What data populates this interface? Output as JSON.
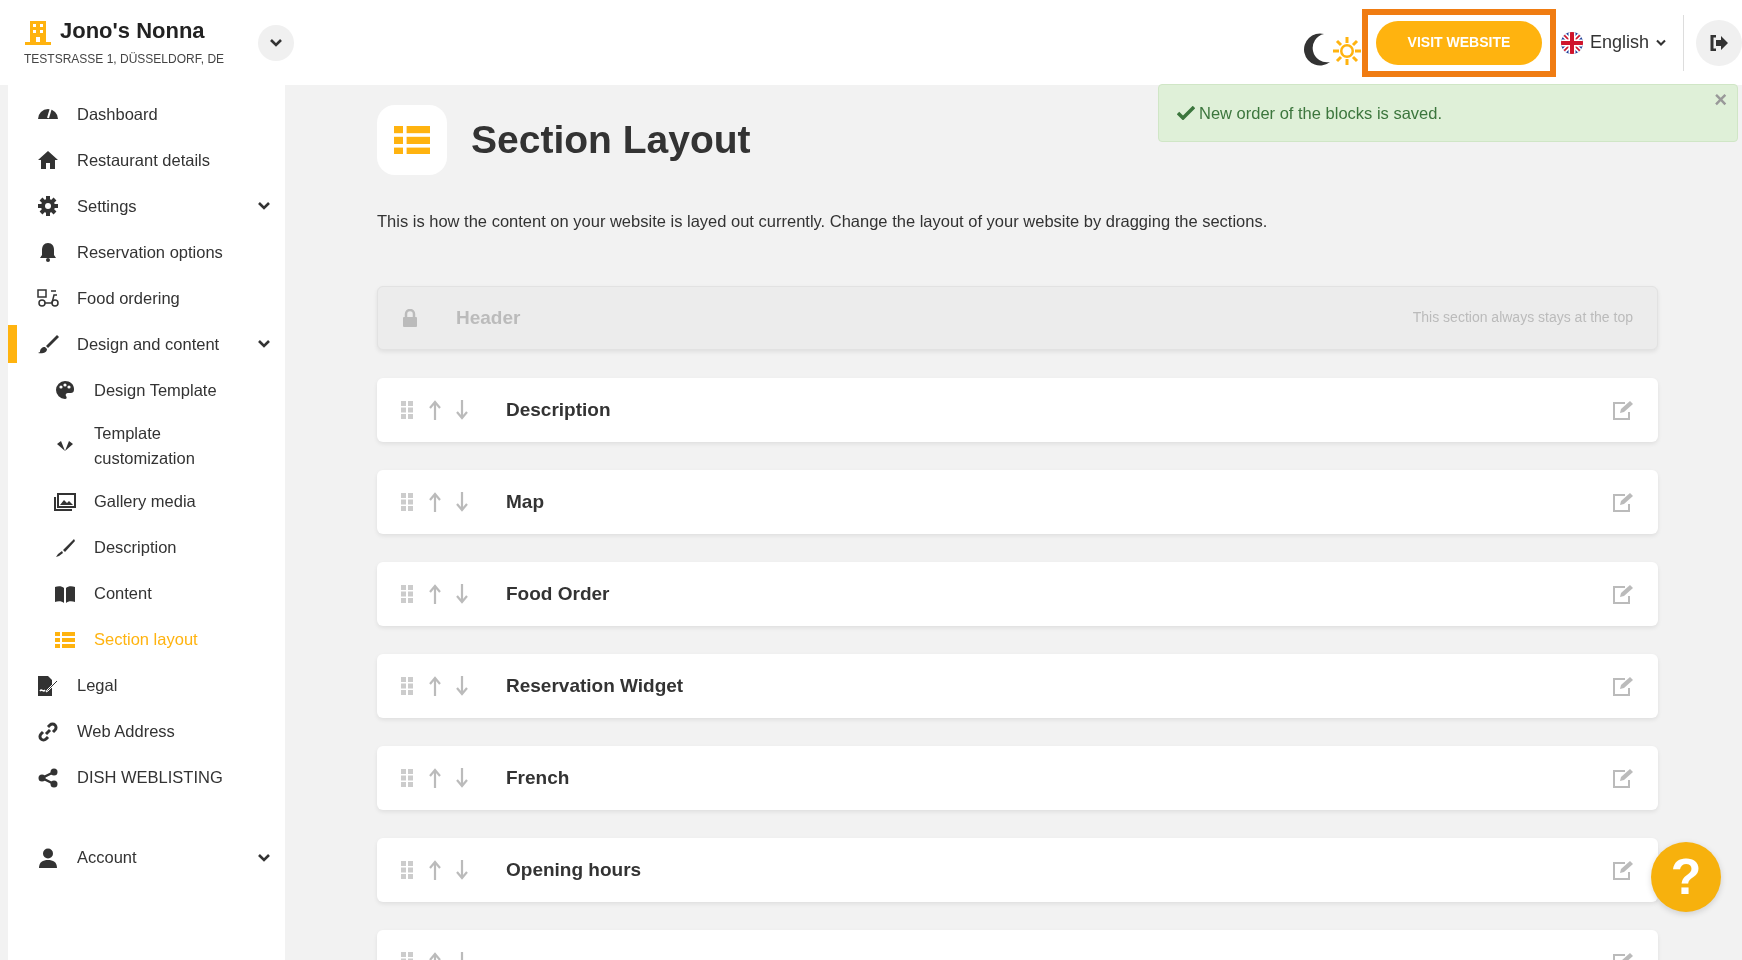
{
  "brand": {
    "name": "Jono's Nonna",
    "address": "TESTSRASSE 1, DÜSSELDORF, DE"
  },
  "topbar": {
    "visit_button": {
      "label": "VISIT WEBSITE",
      "highlighted": true
    },
    "language": "English"
  },
  "alert": {
    "message": "New order of the blocks is saved.",
    "close": "×"
  },
  "sidebar": {
    "items": [
      {
        "label": "Dashboard",
        "selected": false,
        "expandable": false
      },
      {
        "label": "Restaurant details",
        "selected": false,
        "expandable": false
      },
      {
        "label": "Settings",
        "selected": false,
        "expandable": true
      },
      {
        "label": "Reservation options",
        "selected": false,
        "expandable": false
      },
      {
        "label": "Food ordering",
        "selected": false,
        "expandable": false
      },
      {
        "label": "Design and content",
        "selected": true,
        "expandable": true,
        "children": [
          {
            "label": "Design Template",
            "selected": false
          },
          {
            "label": "Template customization",
            "selected": false
          },
          {
            "label": "Gallery media",
            "selected": false
          },
          {
            "label": "Description",
            "selected": false
          },
          {
            "label": "Content",
            "selected": false
          },
          {
            "label": "Section layout",
            "selected": true
          }
        ]
      },
      {
        "label": "Legal",
        "selected": false,
        "expandable": false
      },
      {
        "label": "Web Address",
        "selected": false,
        "expandable": false
      },
      {
        "label": "DISH WEBLISTING",
        "selected": false,
        "expandable": false
      }
    ],
    "footer_items": [
      {
        "label": "Account",
        "selected": false,
        "expandable": true
      }
    ]
  },
  "page": {
    "title": "Section Layout",
    "intro": "This is how the content on your website is layed out currently. Change the layout of your website by dragging the sections.",
    "fixed_section": {
      "title": "Header",
      "note": "This section always stays at the top"
    },
    "sections": [
      {
        "title": "Description"
      },
      {
        "title": "Map"
      },
      {
        "title": "Food Order"
      },
      {
        "title": "Reservation Widget"
      },
      {
        "title": "French"
      },
      {
        "title": "Opening hours"
      }
    ],
    "more_sections_below": true
  },
  "help_button": {
    "label": "?"
  }
}
